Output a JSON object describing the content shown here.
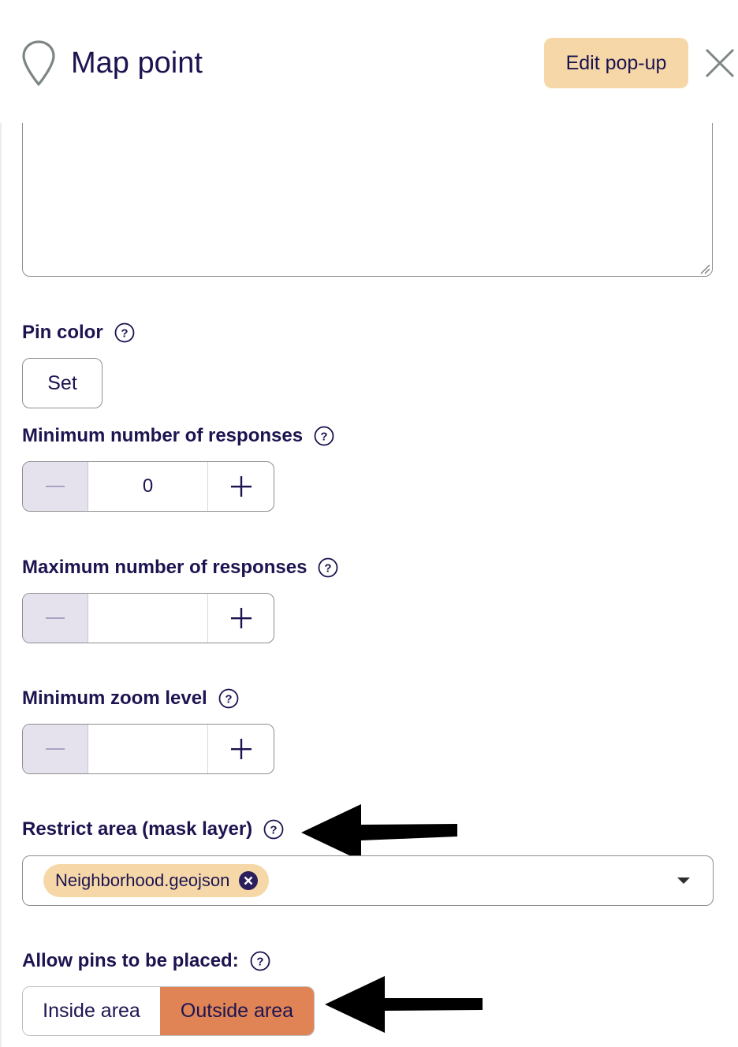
{
  "header": {
    "title": "Map point",
    "edit_popup_label": "Edit pop-up"
  },
  "pin_color": {
    "label": "Pin color",
    "set_label": "Set"
  },
  "min_responses": {
    "label": "Minimum number of responses",
    "value": "0"
  },
  "max_responses": {
    "label": "Maximum number of responses",
    "value": ""
  },
  "min_zoom": {
    "label": "Minimum zoom level",
    "value": ""
  },
  "restrict_area": {
    "label": "Restrict area (mask layer)",
    "selected_chip": "Neighborhood.geojson"
  },
  "allow_pins": {
    "label": "Allow pins to be placed:",
    "options": [
      "Inside area",
      "Outside area"
    ],
    "selected": "Outside area"
  },
  "icons": {
    "pin": "map-pin-icon",
    "close": "close-icon",
    "help": "help-circle-icon",
    "minus": "minus-icon",
    "plus": "plus-icon",
    "chip_remove": "remove-circle-icon",
    "caret": "caret-down-icon",
    "arrow": "arrow-left-icon"
  },
  "colors": {
    "text": "#1c1450",
    "accent_soft": "#f6d8a8",
    "selected_segment": "#e08456",
    "stepper_disabled": "#e5e2ee"
  }
}
